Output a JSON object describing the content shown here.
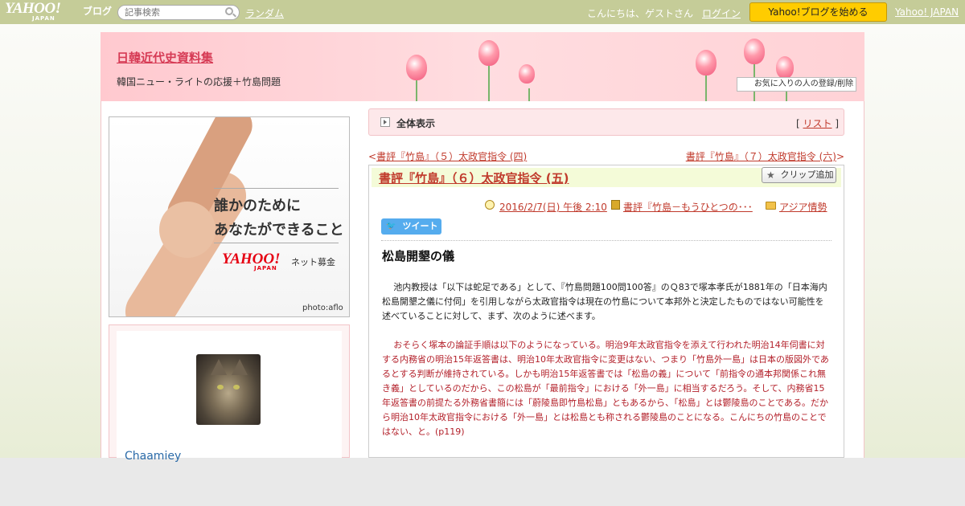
{
  "topbar": {
    "logo_text": "YAHOO!",
    "logo_sub": "JAPAN",
    "logo_blog": "ブログ",
    "search_placeholder": "記事検索",
    "random": "ランダム",
    "greeting": "こんにちは、ゲストさん",
    "login": "ログイン",
    "start_blog": "Yahoo!ブログを始める",
    "yahoo_japan": "Yahoo! JAPAN"
  },
  "header": {
    "blog_title": "日韓近代史資料集",
    "subtitle": "韓国ニュー・ライトの応援＋竹島問題",
    "favorite_button": "お気に入りの人の登録/削除"
  },
  "ad": {
    "line1": "誰かのために",
    "line2": "あなたができること",
    "logo": "YAHOO!",
    "logo_sub": "JAPAN",
    "service": "ネット募金",
    "credit": "photo:aflo"
  },
  "profile": {
    "name": "Chaamiey"
  },
  "nav": {
    "all_view": "全体表示",
    "list_prefix": "[ ",
    "list": "リスト",
    "list_suffix": " ]",
    "prev_arrow": "<",
    "prev": "書評『竹島』（５）太政官指令 (四)",
    "next": "書評『竹島』（７）太政官指令 (六)",
    "next_arrow": ">"
  },
  "post": {
    "title": "書評『竹島』（６）太政官指令 (五)",
    "clip_button": "クリップ追加",
    "date": "2016/2/7(日) 午後 2:10",
    "book": "書評『竹島－もうひとつの･･･",
    "category": "アジア情勢",
    "tweet": "ツイート",
    "heading": "松島開墾の儀",
    "para1": "池内教授は「以下は蛇足である」として、『竹島問題100問100答』のＱ83で塚本孝氏が1881年の「日本海内松島開墾之儀に付伺」を引用しながら太政官指令は現在の竹島について本邦外と決定したものではない可能性を述べていることに対して、まず、次のように述べます。",
    "para2": "おそらく塚本の論証手順は以下のようになっている。明治9年太政官指令を添えて行われた明治14年伺書に対する内務省の明治15年返答書は、明治10年太政官指令に変更はない、つまり「竹島外一島」は日本の版図外であるとする判断が維持されている。しかも明治15年返答書では「松島の義」について「前指令の通本邦関係これ無き義」としているのだから、この松島が「最前指令」における「外一島」に相当するだろう。そして、内務省15年返答書の前提たる外務省書簡には「蔚陵島即竹島松島」ともあるから、「松島」とは鬱陵島のことである。だから明治10年太政官指令における「外一島」とは松島とも称される鬱陵島のことになる。こんにちの竹島のことではない、と。(p119)"
  },
  "colors": {
    "topbar": "#c5cc98",
    "accent": "#c0392b",
    "start_button": "#ffcc00",
    "tweet": "#55acee"
  }
}
